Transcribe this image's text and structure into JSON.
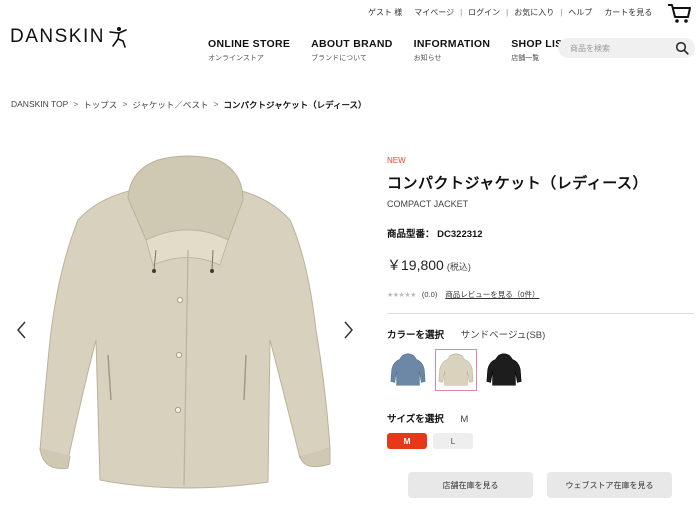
{
  "header": {
    "util_links": [
      "ゲスト 様",
      "マイページ",
      "ログイン",
      "お気に入り",
      "ヘルプ",
      "カートを見る"
    ],
    "logo_text": "DANSKIN",
    "nav": [
      {
        "en": "ONLINE STORE",
        "jp": "オンラインストア"
      },
      {
        "en": "ABOUT BRAND",
        "jp": "ブランドについて"
      },
      {
        "en": "INFORMATION",
        "jp": "お知らせ"
      },
      {
        "en": "SHOP LIST",
        "jp": "店舗一覧"
      }
    ],
    "search_placeholder": "商品を検索",
    "icons": {
      "cart": "cart-icon",
      "search": "search-icon",
      "logo": "dancer-logo-icon"
    }
  },
  "breadcrumb": {
    "items": [
      "DANSKIN TOP",
      "トップス",
      "ジャケット／ベスト"
    ],
    "current": "コンパクトジャケット（レディース）",
    "separator": ">"
  },
  "product": {
    "badge": "NEW",
    "title": "コンパクトジャケット（レディース）",
    "title_en": "COMPACT JACKET",
    "model_label": "商品型番：",
    "model_number": "DC322312",
    "price": "￥19,800",
    "tax": "(税込)",
    "stars": "★★★★★",
    "rating": "(0.0)",
    "review_link": "商品レビューを見る（0件）",
    "color_label": "カラーを選択",
    "selected_color": "サンドベージュ(SB)",
    "colors": [
      {
        "name": "blue",
        "hex": "#6d87a6"
      },
      {
        "name": "sand-beige",
        "hex": "#d9d2bd"
      },
      {
        "name": "black",
        "hex": "#1d1d1d"
      }
    ],
    "size_label": "サイズを選択",
    "selected_size": "M",
    "sizes": [
      "M",
      "L"
    ],
    "store_stock_button": "店舗在庫を見る",
    "web_stock_button": "ウェブストア在庫を見る"
  },
  "colors": {
    "accent_red": "#e53a19",
    "new_badge": "#e8452a",
    "selected_swatch_border": "#d98aa2",
    "jacket_beige": "#d8d1bd"
  }
}
